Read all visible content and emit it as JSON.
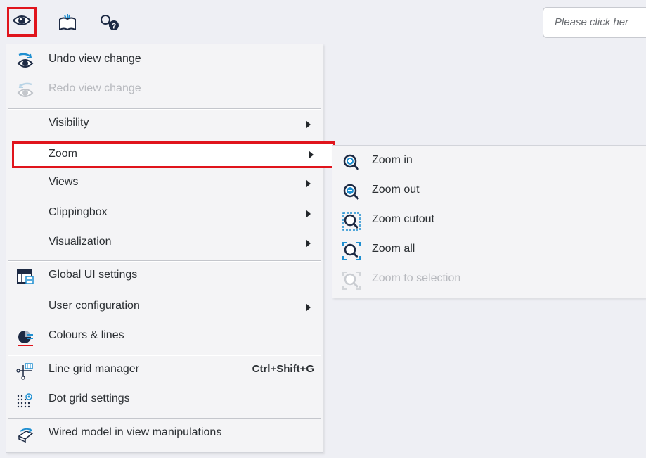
{
  "toolbar": {
    "buttons": [
      {
        "icon": "eye-icon",
        "highlighted": true
      },
      {
        "icon": "book-icon"
      },
      {
        "icon": "search-help-icon"
      }
    ],
    "hint": "Please click her"
  },
  "menu": {
    "items": [
      {
        "label": "Undo view change",
        "icon": "undo-view-icon"
      },
      {
        "label": "Redo view change",
        "icon": "redo-view-icon",
        "disabled": true
      },
      {
        "label": "Visibility",
        "submenu": true
      },
      {
        "label": "Zoom",
        "submenu": true,
        "selected": true
      },
      {
        "label": "Views",
        "submenu": true
      },
      {
        "label": "Clippingbox",
        "submenu": true
      },
      {
        "label": "Visualization",
        "submenu": true
      },
      {
        "label": "Global UI settings",
        "icon": "global-settings-icon"
      },
      {
        "label": "User configuration",
        "submenu": true
      },
      {
        "label": "Colours & lines",
        "icon": "colours-lines-icon"
      },
      {
        "label": "Line grid manager",
        "icon": "line-grid-icon",
        "shortcut": "Ctrl+Shift+G"
      },
      {
        "label": "Dot grid settings",
        "icon": "dot-grid-icon"
      },
      {
        "label": "Wired model in view manipulations",
        "icon": "wired-model-icon"
      }
    ]
  },
  "zoom_submenu": {
    "items": [
      {
        "label": "Zoom in",
        "icon": "zoom-in-icon"
      },
      {
        "label": "Zoom out",
        "icon": "zoom-out-icon"
      },
      {
        "label": "Zoom cutout",
        "icon": "zoom-cutout-icon"
      },
      {
        "label": "Zoom all",
        "icon": "zoom-all-icon"
      },
      {
        "label": "Zoom to selection",
        "icon": "zoom-selection-icon",
        "disabled": true
      }
    ]
  },
  "colors": {
    "highlight": "#e0141c",
    "accent": "#1f8fd1",
    "icon_dark": "#1d2a44"
  }
}
